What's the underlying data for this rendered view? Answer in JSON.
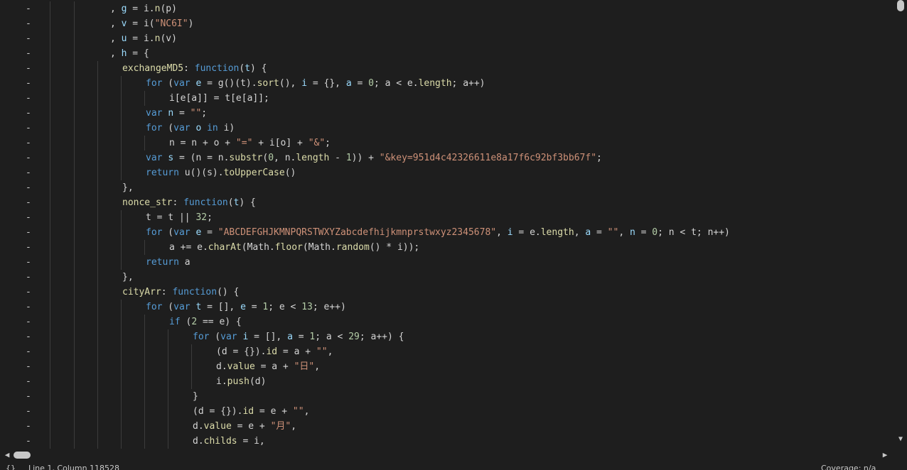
{
  "editor": {
    "gutter_marker": "-",
    "lines": [
      {
        "indent": 1,
        "tokens": [
          [
            "punc",
            ", "
          ],
          [
            "var",
            "g"
          ],
          [
            "punc",
            " = "
          ],
          [
            "id",
            "i"
          ],
          [
            "punc",
            "."
          ],
          [
            "prop",
            "n"
          ],
          [
            "punc",
            "(p)"
          ]
        ]
      },
      {
        "indent": 1,
        "tokens": [
          [
            "punc",
            ", "
          ],
          [
            "var",
            "v"
          ],
          [
            "punc",
            " = "
          ],
          [
            "id",
            "i"
          ],
          [
            "punc",
            "("
          ],
          [
            "str",
            "\"NC6I\""
          ],
          [
            "punc",
            ")"
          ]
        ]
      },
      {
        "indent": 1,
        "tokens": [
          [
            "punc",
            ", "
          ],
          [
            "var",
            "u"
          ],
          [
            "punc",
            " = "
          ],
          [
            "id",
            "i"
          ],
          [
            "punc",
            "."
          ],
          [
            "prop",
            "n"
          ],
          [
            "punc",
            "(v)"
          ]
        ]
      },
      {
        "indent": 1,
        "tokens": [
          [
            "punc",
            ", "
          ],
          [
            "var",
            "h"
          ],
          [
            "punc",
            " = {"
          ]
        ]
      },
      {
        "indent": 2,
        "tokens": [
          [
            "key",
            "exchangeMD5"
          ],
          [
            "punc",
            ": "
          ],
          [
            "kw",
            "function"
          ],
          [
            "punc",
            "("
          ],
          [
            "var",
            "t"
          ],
          [
            "punc",
            ") {"
          ]
        ]
      },
      {
        "indent": 3,
        "tokens": [
          [
            "kw",
            "for"
          ],
          [
            "punc",
            " ("
          ],
          [
            "kw",
            "var"
          ],
          [
            "punc",
            " "
          ],
          [
            "var",
            "e"
          ],
          [
            "punc",
            " = g()(t)."
          ],
          [
            "prop",
            "sort"
          ],
          [
            "punc",
            "(), "
          ],
          [
            "var",
            "i"
          ],
          [
            "punc",
            " = {}, "
          ],
          [
            "var",
            "a"
          ],
          [
            "punc",
            " = "
          ],
          [
            "num",
            "0"
          ],
          [
            "punc",
            "; a < e."
          ],
          [
            "prop",
            "length"
          ],
          [
            "punc",
            "; a++)"
          ]
        ]
      },
      {
        "indent": 4,
        "tokens": [
          [
            "punc",
            "i[e[a]] = t[e[a]];"
          ]
        ]
      },
      {
        "indent": 3,
        "tokens": [
          [
            "kw",
            "var"
          ],
          [
            "punc",
            " "
          ],
          [
            "var",
            "n"
          ],
          [
            "punc",
            " = "
          ],
          [
            "str",
            "\"\""
          ],
          [
            "punc",
            ";"
          ]
        ]
      },
      {
        "indent": 3,
        "tokens": [
          [
            "kw",
            "for"
          ],
          [
            "punc",
            " ("
          ],
          [
            "kw",
            "var"
          ],
          [
            "punc",
            " "
          ],
          [
            "var",
            "o"
          ],
          [
            "punc",
            " "
          ],
          [
            "kw",
            "in"
          ],
          [
            "punc",
            " i)"
          ]
        ]
      },
      {
        "indent": 4,
        "tokens": [
          [
            "punc",
            "n = n + o + "
          ],
          [
            "str",
            "\"=\""
          ],
          [
            "punc",
            " + i[o] + "
          ],
          [
            "str",
            "\"&\""
          ],
          [
            "punc",
            ";"
          ]
        ]
      },
      {
        "indent": 3,
        "tokens": [
          [
            "kw",
            "var"
          ],
          [
            "punc",
            " "
          ],
          [
            "var",
            "s"
          ],
          [
            "punc",
            " = (n = n."
          ],
          [
            "prop",
            "substr"
          ],
          [
            "punc",
            "("
          ],
          [
            "num",
            "0"
          ],
          [
            "punc",
            ", n."
          ],
          [
            "prop",
            "length"
          ],
          [
            "punc",
            " - "
          ],
          [
            "num",
            "1"
          ],
          [
            "punc",
            ")) + "
          ],
          [
            "str",
            "\"&key=951d4c42326611e8a17f6c92bf3bb67f\""
          ],
          [
            "punc",
            ";"
          ]
        ]
      },
      {
        "indent": 3,
        "tokens": [
          [
            "kw",
            "return"
          ],
          [
            "punc",
            " u()(s)."
          ],
          [
            "prop",
            "toUpperCase"
          ],
          [
            "punc",
            "()"
          ]
        ]
      },
      {
        "indent": 2,
        "tokens": [
          [
            "punc",
            "},"
          ]
        ]
      },
      {
        "indent": 2,
        "tokens": [
          [
            "key",
            "nonce_str"
          ],
          [
            "punc",
            ": "
          ],
          [
            "kw",
            "function"
          ],
          [
            "punc",
            "("
          ],
          [
            "var",
            "t"
          ],
          [
            "punc",
            ") {"
          ]
        ]
      },
      {
        "indent": 3,
        "tokens": [
          [
            "punc",
            "t = t || "
          ],
          [
            "num",
            "32"
          ],
          [
            "punc",
            ";"
          ]
        ]
      },
      {
        "indent": 3,
        "tokens": [
          [
            "kw",
            "for"
          ],
          [
            "punc",
            " ("
          ],
          [
            "kw",
            "var"
          ],
          [
            "punc",
            " "
          ],
          [
            "var",
            "e"
          ],
          [
            "punc",
            " = "
          ],
          [
            "str",
            "\"ABCDEFGHJKMNPQRSTWXYZabcdefhijkmnprstwxyz2345678\""
          ],
          [
            "punc",
            ", "
          ],
          [
            "var",
            "i"
          ],
          [
            "punc",
            " = e."
          ],
          [
            "prop",
            "length"
          ],
          [
            "punc",
            ", "
          ],
          [
            "var",
            "a"
          ],
          [
            "punc",
            " = "
          ],
          [
            "str",
            "\"\""
          ],
          [
            "punc",
            ", "
          ],
          [
            "var",
            "n"
          ],
          [
            "punc",
            " = "
          ],
          [
            "num",
            "0"
          ],
          [
            "punc",
            "; n < t; n++)"
          ]
        ]
      },
      {
        "indent": 4,
        "tokens": [
          [
            "punc",
            "a += e."
          ],
          [
            "prop",
            "charAt"
          ],
          [
            "punc",
            "(Math."
          ],
          [
            "prop",
            "floor"
          ],
          [
            "punc",
            "(Math."
          ],
          [
            "prop",
            "random"
          ],
          [
            "punc",
            "() * i));"
          ]
        ]
      },
      {
        "indent": 3,
        "tokens": [
          [
            "kw",
            "return"
          ],
          [
            "punc",
            " a"
          ]
        ]
      },
      {
        "indent": 2,
        "tokens": [
          [
            "punc",
            "},"
          ]
        ]
      },
      {
        "indent": 2,
        "tokens": [
          [
            "key",
            "cityArr"
          ],
          [
            "punc",
            ": "
          ],
          [
            "kw",
            "function"
          ],
          [
            "punc",
            "() {"
          ]
        ]
      },
      {
        "indent": 3,
        "tokens": [
          [
            "kw",
            "for"
          ],
          [
            "punc",
            " ("
          ],
          [
            "kw",
            "var"
          ],
          [
            "punc",
            " "
          ],
          [
            "var",
            "t"
          ],
          [
            "punc",
            " = [], "
          ],
          [
            "var",
            "e"
          ],
          [
            "punc",
            " = "
          ],
          [
            "num",
            "1"
          ],
          [
            "punc",
            "; e < "
          ],
          [
            "num",
            "13"
          ],
          [
            "punc",
            "; e++)"
          ]
        ]
      },
      {
        "indent": 4,
        "tokens": [
          [
            "kw",
            "if"
          ],
          [
            "punc",
            " ("
          ],
          [
            "num",
            "2"
          ],
          [
            "punc",
            " == e) {"
          ]
        ]
      },
      {
        "indent": 5,
        "tokens": [
          [
            "kw",
            "for"
          ],
          [
            "punc",
            " ("
          ],
          [
            "kw",
            "var"
          ],
          [
            "punc",
            " "
          ],
          [
            "var",
            "i"
          ],
          [
            "punc",
            " = [], "
          ],
          [
            "var",
            "a"
          ],
          [
            "punc",
            " = "
          ],
          [
            "num",
            "1"
          ],
          [
            "punc",
            "; a < "
          ],
          [
            "num",
            "29"
          ],
          [
            "punc",
            "; a++) {"
          ]
        ]
      },
      {
        "indent": 6,
        "tokens": [
          [
            "punc",
            "(d = {})."
          ],
          [
            "prop",
            "id"
          ],
          [
            "punc",
            " = a + "
          ],
          [
            "str",
            "\"\""
          ],
          [
            "punc",
            ","
          ]
        ]
      },
      {
        "indent": 6,
        "tokens": [
          [
            "punc",
            "d."
          ],
          [
            "prop",
            "value"
          ],
          [
            "punc",
            " = a + "
          ],
          [
            "str",
            "\"日\""
          ],
          [
            "punc",
            ","
          ]
        ]
      },
      {
        "indent": 6,
        "tokens": [
          [
            "punc",
            "i."
          ],
          [
            "prop",
            "push"
          ],
          [
            "punc",
            "(d)"
          ]
        ]
      },
      {
        "indent": 5,
        "tokens": [
          [
            "punc",
            "}"
          ]
        ]
      },
      {
        "indent": 5,
        "tokens": [
          [
            "punc",
            "(d = {})."
          ],
          [
            "prop",
            "id"
          ],
          [
            "punc",
            " = e + "
          ],
          [
            "str",
            "\"\""
          ],
          [
            "punc",
            ","
          ]
        ]
      },
      {
        "indent": 5,
        "tokens": [
          [
            "punc",
            "d."
          ],
          [
            "prop",
            "value"
          ],
          [
            "punc",
            " = e + "
          ],
          [
            "str",
            "\"月\""
          ],
          [
            "punc",
            ","
          ]
        ]
      },
      {
        "indent": 5,
        "tokens": [
          [
            "punc",
            "d."
          ],
          [
            "prop",
            "childs"
          ],
          [
            "punc",
            " = i,"
          ]
        ]
      }
    ]
  },
  "colors": {
    "background": "#1e1e1e",
    "keyword": "#569cd6",
    "function": "#dcdcaa",
    "string": "#ce9178",
    "number": "#b5cea8",
    "variable": "#9cdcfe",
    "text": "#d4d4d4"
  },
  "scrollbars": {
    "up_icon": "chevron-up-icon",
    "down_icon": "chevron-down-icon",
    "left_icon": "chevron-left-icon",
    "right_icon": "chevron-right-icon"
  },
  "statusbar": {
    "icon": "{}",
    "left_text": "Line 1, Column 118528",
    "right_text": "Coverage: n/a"
  }
}
